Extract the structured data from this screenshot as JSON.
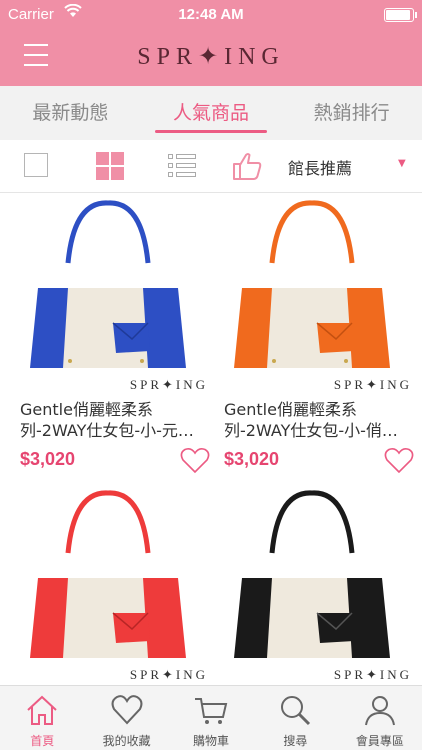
{
  "status_bar": {
    "carrier": "Carrier",
    "time": "12:48 AM"
  },
  "header": {
    "logo": "SPR✦ING"
  },
  "tabs": [
    {
      "label": "最新動態"
    },
    {
      "label": "人氣商品",
      "active": true
    },
    {
      "label": "熱銷排行"
    }
  ],
  "toolbar": {
    "sort_label": "館長推薦",
    "accent": "#f08fa6"
  },
  "products": [
    {
      "line1": "Gentle俏麗輕柔系",
      "line2": "列-2WAY仕女包-小-元…",
      "price": "$3,020",
      "brand": "SPR✦ING",
      "color": "#2d4fc4"
    },
    {
      "line1": "Gentle俏麗輕柔系",
      "line2": "列-2WAY仕女包-小-俏…",
      "price": "$3,020",
      "brand": "SPR✦ING",
      "color": "#f06a1e"
    },
    {
      "brand": "SPR✦ING",
      "color": "#ee3b3b"
    },
    {
      "brand": "SPR✦ING",
      "color": "#1a1a1a"
    }
  ],
  "bottom_nav": [
    {
      "label": "首頁",
      "icon": "home-icon",
      "active": true
    },
    {
      "label": "我的收藏",
      "icon": "heart-icon"
    },
    {
      "label": "購物車",
      "icon": "cart-icon"
    },
    {
      "label": "搜尋",
      "icon": "search-icon"
    },
    {
      "label": "會員專區",
      "icon": "user-icon"
    }
  ]
}
